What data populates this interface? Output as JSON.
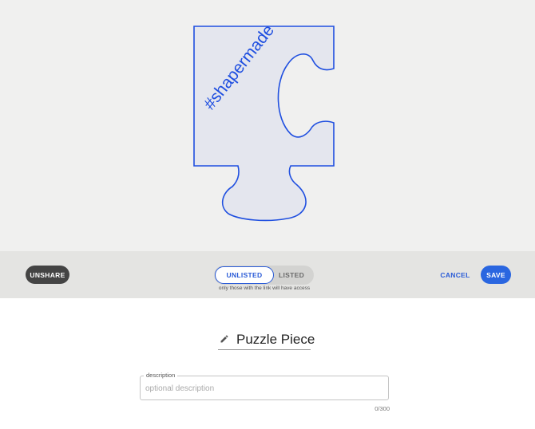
{
  "preview": {
    "shape_text": "#shapermade",
    "fill_color": "#e4e6ee",
    "stroke_color": "#1f4fe0"
  },
  "toolbar": {
    "unshare_label": "UNSHARE",
    "visibility": {
      "options": [
        "UNLISTED",
        "LISTED"
      ],
      "selected": "UNLISTED",
      "helper_text": "only those with the link will have access"
    },
    "cancel_label": "CANCEL",
    "save_label": "SAVE"
  },
  "design": {
    "title": "Puzzle Piece",
    "edit_icon": "pencil-icon"
  },
  "description": {
    "label": "description",
    "placeholder": "optional description",
    "value": "",
    "counter": "0/300"
  },
  "colors": {
    "accent": "#2a66e0",
    "dark_button": "#444444",
    "toolbar_bg": "#e4e4e2",
    "preview_bg": "#f0f0ef"
  }
}
